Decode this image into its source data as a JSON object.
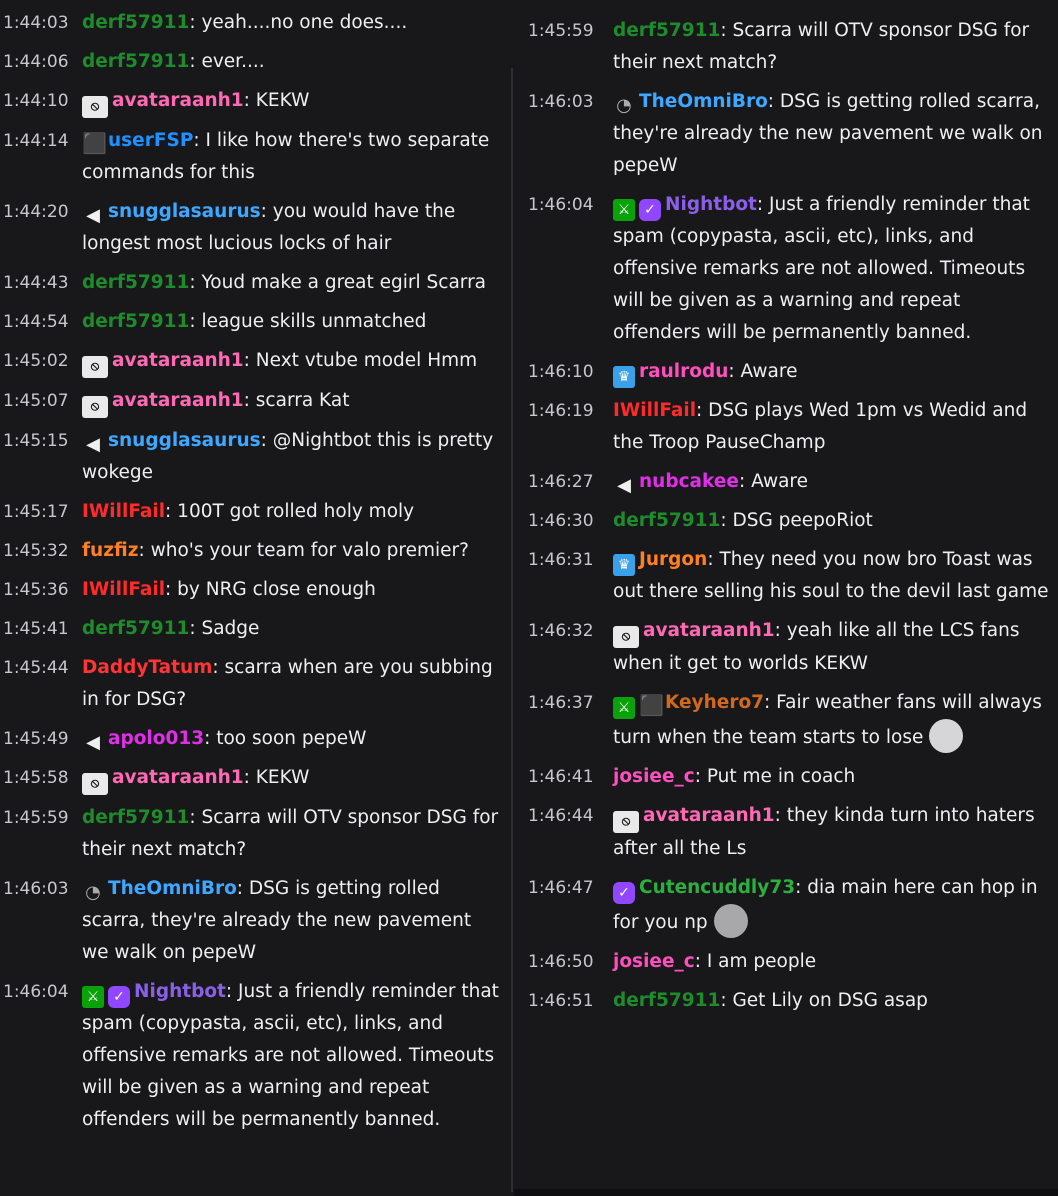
{
  "icons": {
    "mute": "broadcaster-eye-slash-icon",
    "no_audio": "no-audio-icon",
    "gift": "sub-gifter-icon",
    "mod": "moderator-sword-icon",
    "verified": "verified-bot-icon",
    "prime": "prime-crown-icon",
    "glasses": "glasses-icon"
  },
  "colors": {
    "background": "#18181b",
    "text": "#efeff1",
    "timestamp": "#c8c8cc"
  },
  "left_messages": [
    {
      "ts": "1:44:03",
      "user": "derf57911",
      "color": "green",
      "badges": [],
      "text": "yeah....no one does...."
    },
    {
      "ts": "1:44:06",
      "user": "derf57911",
      "color": "green",
      "badges": [],
      "text": "ever...."
    },
    {
      "ts": "1:44:10",
      "user": "avataraanh1",
      "color": "pink",
      "badges": [
        "mute"
      ],
      "text": "KEKW"
    },
    {
      "ts": "1:44:14",
      "user": "userFSP",
      "color": "blue",
      "badges": [
        "gift"
      ],
      "text": "I like how there's two separate commands for this"
    },
    {
      "ts": "1:44:20",
      "user": "snugglasaurus",
      "color": "skyblue",
      "badges": [
        "no_audio"
      ],
      "text": "you would have the longest most lucious locks of hair"
    },
    {
      "ts": "1:44:43",
      "user": "derf57911",
      "color": "green",
      "badges": [],
      "text": "Youd make a great egirl Scarra"
    },
    {
      "ts": "1:44:54",
      "user": "derf57911",
      "color": "green",
      "badges": [],
      "text": "league skills unmatched"
    },
    {
      "ts": "1:45:02",
      "user": "avataraanh1",
      "color": "pink",
      "badges": [
        "mute"
      ],
      "text": "Next vtube model Hmm"
    },
    {
      "ts": "1:45:07",
      "user": "avataraanh1",
      "color": "pink",
      "badges": [
        "mute"
      ],
      "text": "scarra Kat"
    },
    {
      "ts": "1:45:15",
      "user": "snugglasaurus",
      "color": "skyblue",
      "badges": [
        "no_audio"
      ],
      "text": "@Nightbot this is pretty wokege"
    },
    {
      "ts": "1:45:17",
      "user": "IWillFail",
      "color": "red",
      "badges": [],
      "text": "100T got rolled holy moly"
    },
    {
      "ts": "1:45:32",
      "user": "fuzfiz",
      "color": "orange",
      "badges": [],
      "text": "who's your team for valo premier?"
    },
    {
      "ts": "1:45:36",
      "user": "IWillFail",
      "color": "red",
      "badges": [],
      "text": "by NRG close enough"
    },
    {
      "ts": "1:45:41",
      "user": "derf57911",
      "color": "green",
      "badges": [],
      "text": "Sadge"
    },
    {
      "ts": "1:45:44",
      "user": "DaddyTatum",
      "color": "firebrick",
      "badges": [],
      "text": "scarra when are you subbing in for DSG?"
    },
    {
      "ts": "1:45:49",
      "user": "apolo013",
      "color": "magenta",
      "badges": [
        "no_audio"
      ],
      "text": "too soon pepeW"
    },
    {
      "ts": "1:45:58",
      "user": "avataraanh1",
      "color": "pink",
      "badges": [
        "mute"
      ],
      "text": "KEKW"
    },
    {
      "ts": "1:45:59",
      "user": "derf57911",
      "color": "green",
      "badges": [],
      "text": "Scarra will OTV sponsor DSG for their next match?"
    },
    {
      "ts": "1:46:03",
      "user": "TheOmniBro",
      "color": "skyblue",
      "badges": [
        "glasses"
      ],
      "text": "DSG is getting rolled scarra, they're already the new pavement we walk on pepeW"
    },
    {
      "ts": "1:46:04",
      "user": "Nightbot",
      "color": "violet",
      "badges": [
        "mod",
        "verified"
      ],
      "text": "Just a friendly reminder that spam (copypasta, ascii, etc), links, and offensive remarks are not allowed. Timeouts will be given as a warning and repeat offenders will be permanently banned."
    }
  ],
  "right_messages": [
    {
      "ts": "1:45:59",
      "user": "derf57911",
      "color": "green",
      "badges": [],
      "text": "Scarra will OTV sponsor DSG for their next match?"
    },
    {
      "ts": "1:46:03",
      "user": "TheOmniBro",
      "color": "skyblue",
      "badges": [
        "glasses"
      ],
      "text": "DSG is getting rolled scarra, they're already the new pavement we walk on pepeW"
    },
    {
      "ts": "1:46:04",
      "user": "Nightbot",
      "color": "violet",
      "badges": [
        "mod",
        "verified"
      ],
      "text": "Just a friendly reminder that spam (copypasta, ascii, etc), links, and offensive remarks are not allowed. Timeouts will be given as a warning and repeat offenders will be permanently banned."
    },
    {
      "ts": "1:46:10",
      "user": "raulrodu",
      "color": "hotpink",
      "badges": [
        "prime"
      ],
      "text": "Aware"
    },
    {
      "ts": "1:46:19",
      "user": "IWillFail",
      "color": "red",
      "badges": [],
      "text": "DSG plays Wed 1pm vs Wedid and the Troop PauseChamp"
    },
    {
      "ts": "1:46:27",
      "user": "nubcakee",
      "color": "magenta",
      "badges": [
        "no_audio"
      ],
      "text": "Aware"
    },
    {
      "ts": "1:46:30",
      "user": "derf57911",
      "color": "green",
      "badges": [],
      "text": "DSG peepoRiot"
    },
    {
      "ts": "1:46:31",
      "user": "Jurgon",
      "color": "orange",
      "badges": [
        "prime"
      ],
      "text": "They need you now bro Toast was out there selling his soul to the devil last game"
    },
    {
      "ts": "1:46:32",
      "user": "avataraanh1",
      "color": "pink",
      "badges": [
        "mute"
      ],
      "text": "yeah like all the LCS fans when it get to worlds KEKW"
    },
    {
      "ts": "1:46:37",
      "user": "Keyhero7",
      "color": "gold",
      "badges": [
        "mod",
        "gift"
      ],
      "text": "Fair weather fans will always turn when the team starts to lose",
      "emote": "cry"
    },
    {
      "ts": "1:46:41",
      "user": "josiee_c",
      "color": "hotpink",
      "badges": [],
      "text": "Put me in coach"
    },
    {
      "ts": "1:46:44",
      "user": "avataraanh1",
      "color": "pink",
      "badges": [
        "mute"
      ],
      "text": "they kinda turn into haters after all the Ls"
    },
    {
      "ts": "1:46:47",
      "user": "Cutencuddly73",
      "color": "lime",
      "badges": [
        "verified"
      ],
      "text": "dia main here can hop in for you np",
      "emote": "face"
    },
    {
      "ts": "1:46:50",
      "user": "josiee_c",
      "color": "hotpink",
      "badges": [],
      "text": "I am people"
    },
    {
      "ts": "1:46:51",
      "user": "derf57911",
      "color": "green",
      "badges": [],
      "text": "Get Lily on DSG asap"
    }
  ]
}
